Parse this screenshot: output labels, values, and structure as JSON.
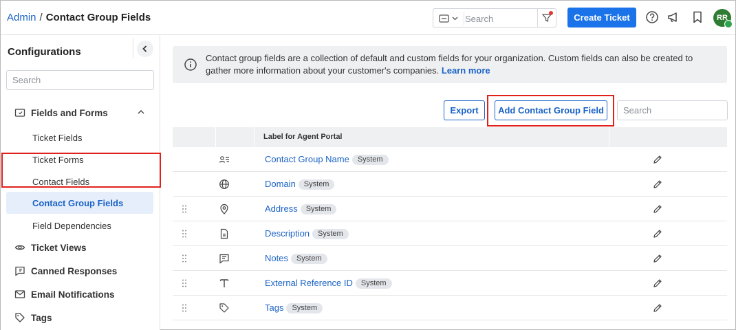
{
  "header": {
    "breadcrumb_root": "Admin",
    "breadcrumb_sep": "/",
    "breadcrumb_current": "Contact Group Fields",
    "search_placeholder": "Search",
    "create_button": "Create Ticket",
    "avatar_initials": "RR"
  },
  "sidebar": {
    "title": "Configurations",
    "search_placeholder": "Search",
    "group": "Fields and Forms",
    "items": [
      "Ticket Fields",
      "Ticket Forms",
      "Contact Fields",
      "Contact Group Fields",
      "Field Dependencies"
    ],
    "active_index": 3,
    "sections": [
      "Ticket Views",
      "Canned Responses",
      "Email Notifications",
      "Tags"
    ]
  },
  "main": {
    "info_text": "Contact group fields are a collection of default and custom fields for your organization. Custom fields can also be created to gather more information about your customer's companies.",
    "info_link": "Learn more",
    "export_button": "Export",
    "add_button": "Add Contact Group Field",
    "table_search_placeholder": "Search",
    "column_label": "Label for Agent Portal",
    "rows": [
      {
        "icon": "contact-card-icon",
        "label": "Contact Group Name",
        "badge": "System",
        "draggable": false
      },
      {
        "icon": "globe-icon",
        "label": "Domain",
        "badge": "System",
        "draggable": false
      },
      {
        "icon": "location-pin-icon",
        "label": "Address",
        "badge": "System",
        "draggable": true
      },
      {
        "icon": "document-icon",
        "label": "Description",
        "badge": "System",
        "draggable": true
      },
      {
        "icon": "note-icon",
        "label": "Notes",
        "badge": "System",
        "draggable": true
      },
      {
        "icon": "text-icon",
        "label": "External Reference ID",
        "badge": "System",
        "draggable": true
      },
      {
        "icon": "tag-icon",
        "label": "Tags",
        "badge": "System",
        "draggable": true
      }
    ]
  },
  "colors": {
    "primary": "#1a73e8",
    "link": "#1b63c6",
    "highlight": "#e0211b",
    "active_bg": "#e6eefb",
    "avatar_bg": "#2e7d32"
  }
}
